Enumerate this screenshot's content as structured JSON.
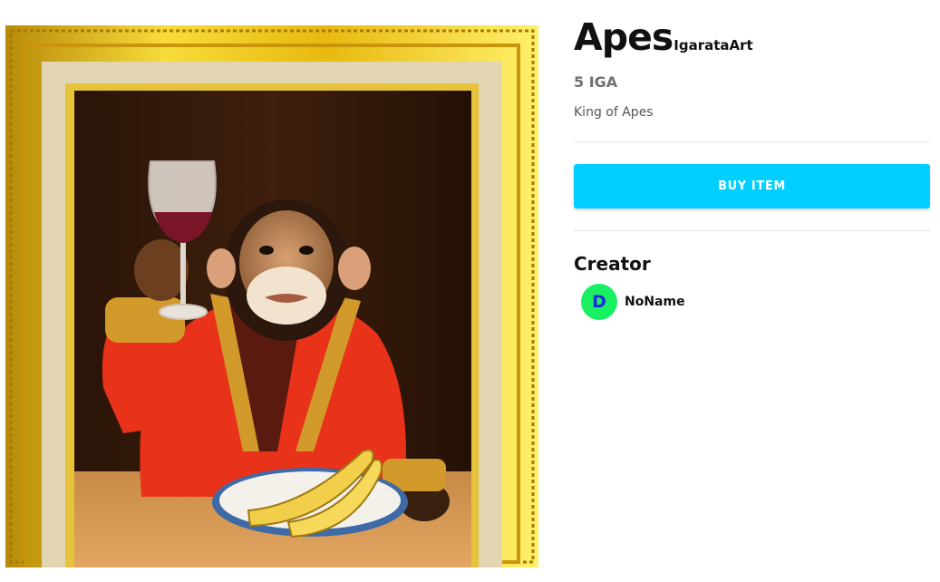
{
  "item": {
    "title": "Apes",
    "collection": "IgarataArt",
    "price": "5 IGA",
    "description": "King of Apes",
    "image_subject": "painting of a chimpanzee in a red robe raising a wine glass beside a plate of bananas, in a gold frame"
  },
  "actions": {
    "buy_label": "BUY ITEM",
    "buy_color": "#00cfff"
  },
  "creator": {
    "heading": "Creator",
    "name": "NoName",
    "avatar_letter": "D",
    "avatar_bg": "#19ef63",
    "avatar_fg": "#1b2bd8"
  }
}
